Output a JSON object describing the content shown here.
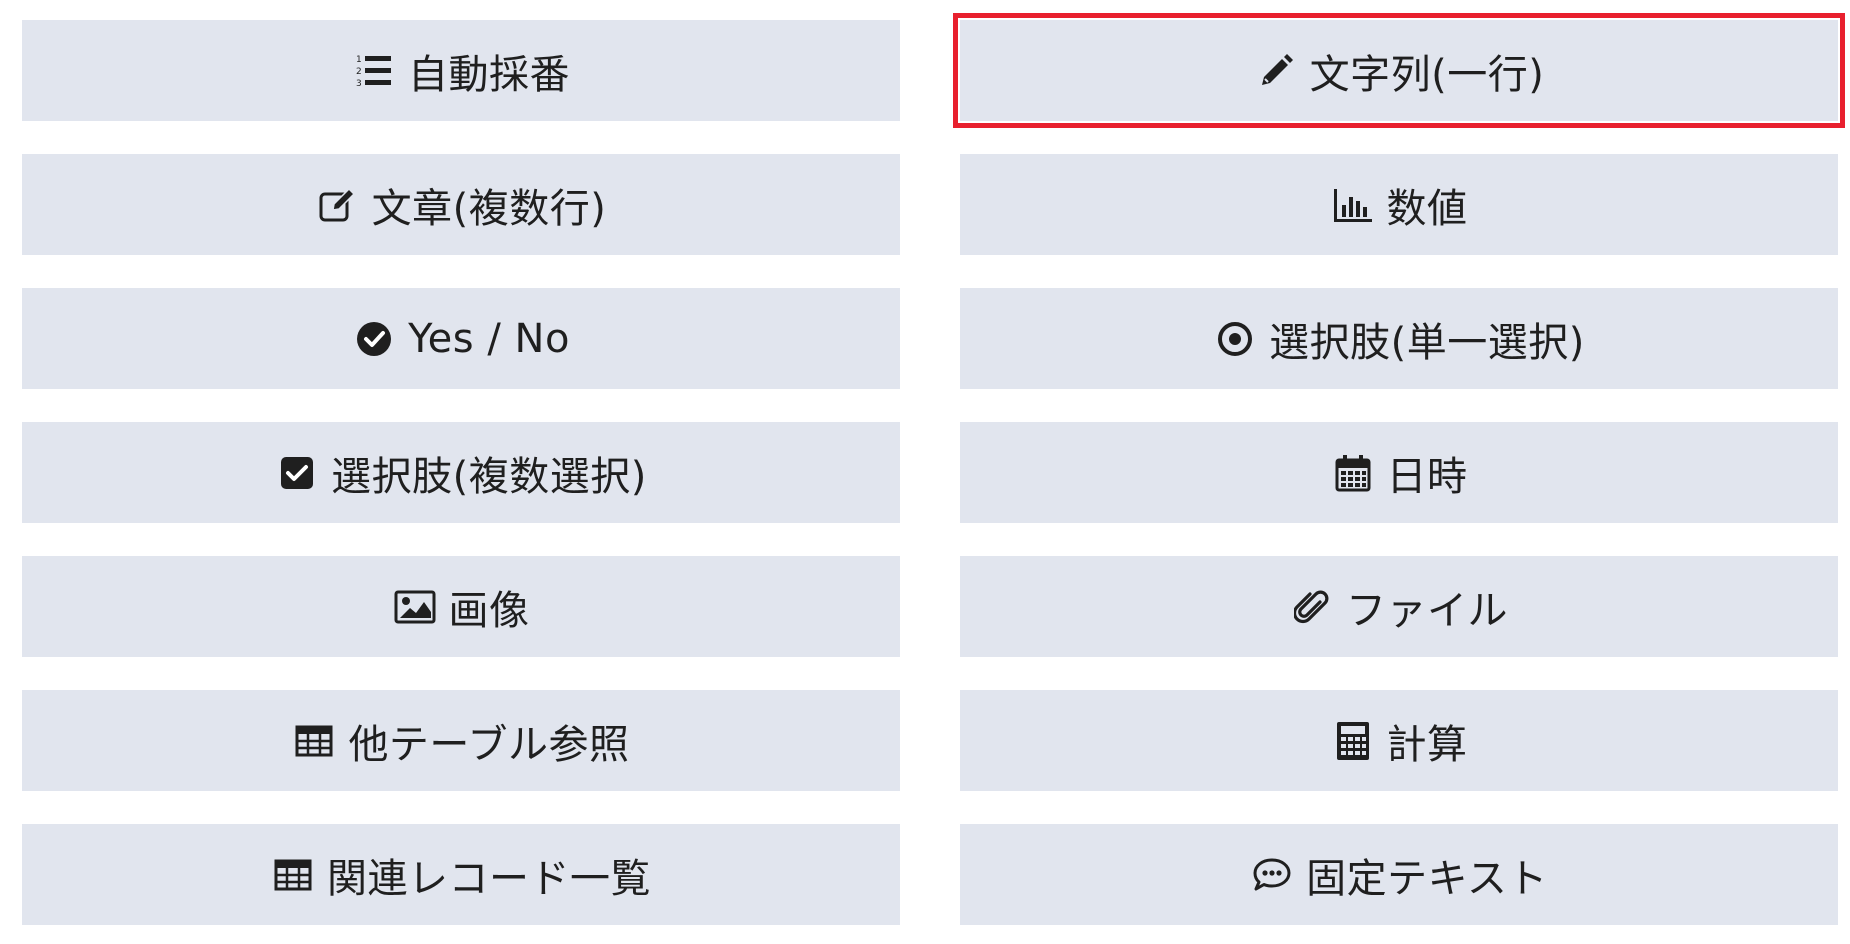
{
  "field_types": {
    "auto_number": {
      "label": "自動採番",
      "icon": "list-ol-icon"
    },
    "text_single": {
      "label": "文字列(一行)",
      "icon": "pencil-icon"
    },
    "text_multi": {
      "label": "文章(複数行)",
      "icon": "edit-icon"
    },
    "number": {
      "label": "数値",
      "icon": "bar-chart-icon"
    },
    "yes_no": {
      "label": "Yes / No",
      "icon": "check-circle-icon"
    },
    "select_single": {
      "label": "選択肢(単一選択)",
      "icon": "radio-icon"
    },
    "select_multi": {
      "label": "選択肢(複数選択)",
      "icon": "checkbox-icon"
    },
    "datetime": {
      "label": "日時",
      "icon": "calendar-icon"
    },
    "image": {
      "label": "画像",
      "icon": "image-icon"
    },
    "file": {
      "label": "ファイル",
      "icon": "paperclip-icon"
    },
    "table_ref": {
      "label": "他テーブル参照",
      "icon": "table-icon"
    },
    "calc": {
      "label": "計算",
      "icon": "calculator-icon"
    },
    "related_list": {
      "label": "関連レコード一覧",
      "icon": "table-icon"
    },
    "fixed_text": {
      "label": "固定テキスト",
      "icon": "comment-icon"
    }
  },
  "selected": "text_single",
  "colors": {
    "button_bg": "#e1e5ee",
    "selection_outline": "#e8202e",
    "text": "#1f1f1f"
  }
}
